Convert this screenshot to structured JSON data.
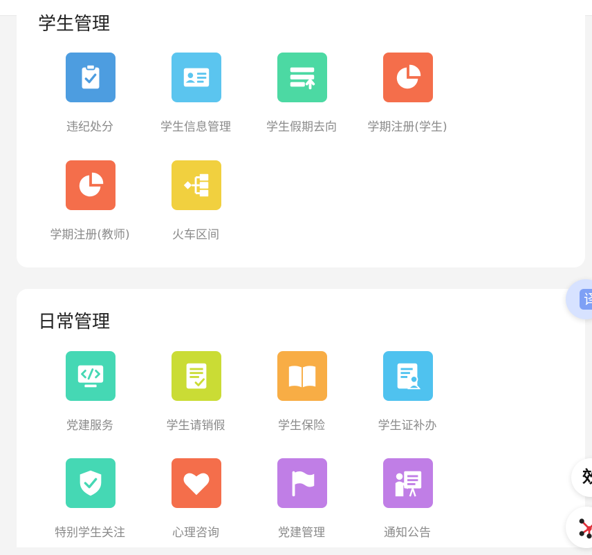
{
  "sections": [
    {
      "title": "学生管理",
      "items": [
        {
          "label": "违纪处分",
          "icon": "clipboard-check-icon",
          "color": "#4d9de0"
        },
        {
          "label": "学生信息管理",
          "icon": "id-card-icon",
          "color": "#5bc5ef"
        },
        {
          "label": "学生假期去向",
          "icon": "list-upload-icon",
          "color": "#4cd9a3"
        },
        {
          "label": "学期注册(学生)",
          "icon": "pie-chart-icon",
          "color": "#f46e4b"
        },
        {
          "label": "学期注册(教师)",
          "icon": "pie-chart-icon",
          "color": "#f46e4b"
        },
        {
          "label": "火车区间",
          "icon": "flow-diagram-icon",
          "color": "#f1d03f"
        }
      ]
    },
    {
      "title": "日常管理",
      "items": [
        {
          "label": "党建服务",
          "icon": "code-monitor-icon",
          "color": "#45d8b4"
        },
        {
          "label": "学生请销假",
          "icon": "document-check-icon",
          "color": "#cadc35"
        },
        {
          "label": "学生保险",
          "icon": "open-book-icon",
          "color": "#f8ad45"
        },
        {
          "label": "学生证补办",
          "icon": "profile-doc-icon",
          "color": "#4fc2ef"
        },
        {
          "label": "特别学生关注",
          "icon": "shield-check-icon",
          "color": "#45d8b4"
        },
        {
          "label": "心理咨询",
          "icon": "heart-icon",
          "color": "#f46e4b"
        },
        {
          "label": "党建管理",
          "icon": "flag-icon",
          "color": "#c07ee6"
        },
        {
          "label": "通知公告",
          "icon": "presentation-icon",
          "color": "#c07ee6"
        }
      ]
    }
  ],
  "floating": {
    "button1_glyph": "译",
    "button2_glyph": "效"
  }
}
